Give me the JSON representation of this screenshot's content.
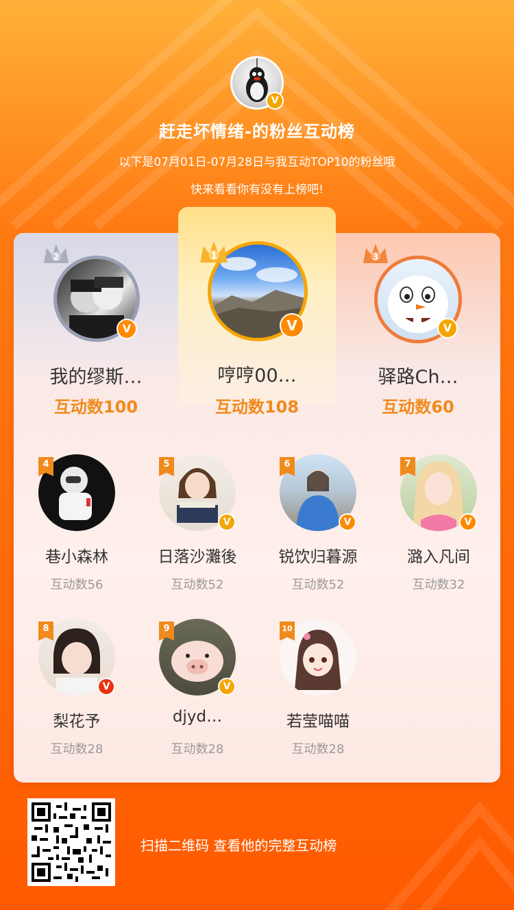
{
  "header": {
    "title": "赶走坏情绪-的粉丝互动榜",
    "subtitle_line1": "以下是07月01日-07月28日与我互动TOP10的粉丝哦",
    "subtitle_line2": "快来看看你有没有上榜吧!",
    "owner_avatar": "penguin-avatar",
    "verified_badge": "V"
  },
  "podium": [
    {
      "rank": "2",
      "name": "我的缪斯…",
      "count": "互动数100",
      "avatar": "two-girls-photo"
    },
    {
      "rank": "1",
      "name": "哼哼00…",
      "count": "互动数108",
      "avatar": "mountain-sky-photo"
    },
    {
      "rank": "3",
      "name": "驿路Ch…",
      "count": "互动数60",
      "avatar": "snowman-olaf"
    }
  ],
  "fans": [
    {
      "rank": "4",
      "name": "巷小森林",
      "count": "互动数56",
      "avatar": "astronaut",
      "verified": false
    },
    {
      "rank": "5",
      "name": "日落沙灘後",
      "count": "互动数52",
      "avatar": "girl-reading",
      "verified": true
    },
    {
      "rank": "6",
      "name": "锐饮归暮源",
      "count": "互动数52",
      "avatar": "girl-beach",
      "verified": true
    },
    {
      "rank": "7",
      "name": "潞入凡间",
      "count": "互动数32",
      "avatar": "blonde-girl",
      "verified": true
    },
    {
      "rank": "8",
      "name": "梨花予",
      "count": "互动数28",
      "avatar": "little-girl",
      "verified": true
    },
    {
      "rank": "9",
      "name": "djyd…",
      "count": "互动数28",
      "avatar": "piglet",
      "verified": true
    },
    {
      "rank": "10",
      "name": "若莹喵喵",
      "count": "互动数28",
      "avatar": "cartoon-girl",
      "verified": false
    }
  ],
  "footer": {
    "text": "扫描二维码 查看他的完整互动榜"
  },
  "colors": {
    "accent": "#f08a1c",
    "background": "#ff6a0a",
    "gold": "#f5a500",
    "silver": "#9aa0b4",
    "bronze": "#f07a3a"
  }
}
